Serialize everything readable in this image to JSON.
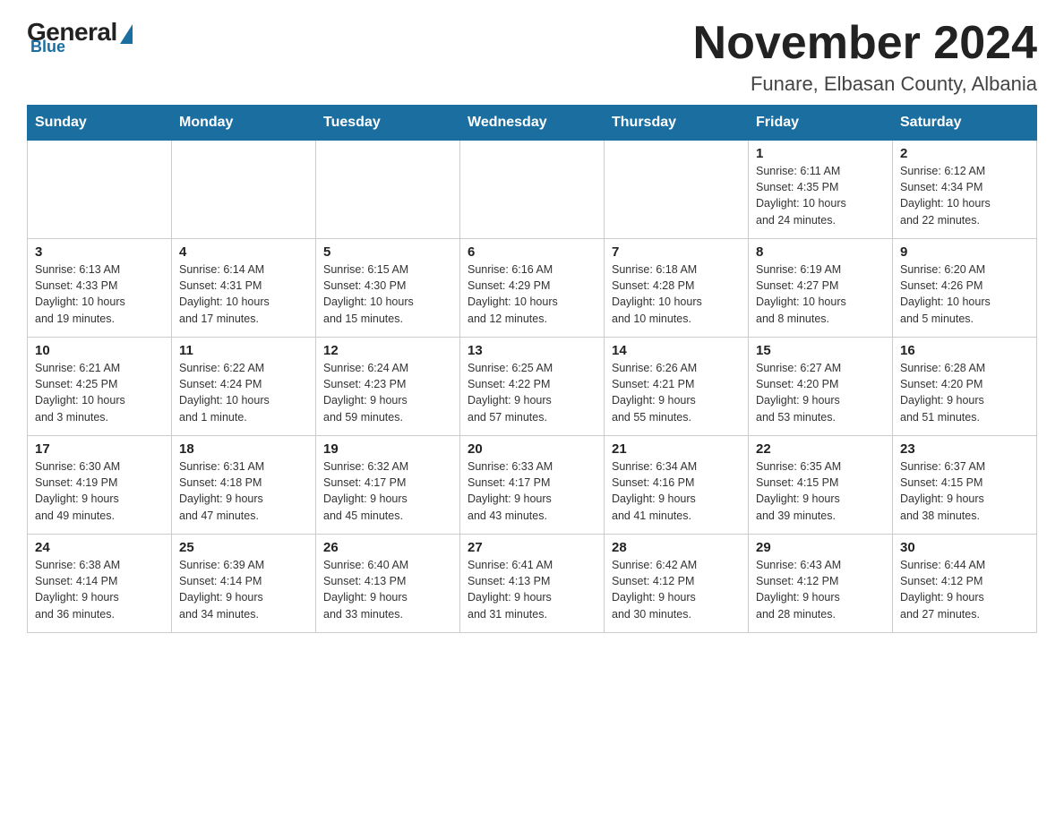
{
  "logo": {
    "general": "General",
    "blue": "Blue",
    "subtitle": "Blue"
  },
  "title": "November 2024",
  "location": "Funare, Elbasan County, Albania",
  "days_of_week": [
    "Sunday",
    "Monday",
    "Tuesday",
    "Wednesday",
    "Thursday",
    "Friday",
    "Saturday"
  ],
  "weeks": [
    [
      {
        "day": "",
        "info": ""
      },
      {
        "day": "",
        "info": ""
      },
      {
        "day": "",
        "info": ""
      },
      {
        "day": "",
        "info": ""
      },
      {
        "day": "",
        "info": ""
      },
      {
        "day": "1",
        "info": "Sunrise: 6:11 AM\nSunset: 4:35 PM\nDaylight: 10 hours\nand 24 minutes."
      },
      {
        "day": "2",
        "info": "Sunrise: 6:12 AM\nSunset: 4:34 PM\nDaylight: 10 hours\nand 22 minutes."
      }
    ],
    [
      {
        "day": "3",
        "info": "Sunrise: 6:13 AM\nSunset: 4:33 PM\nDaylight: 10 hours\nand 19 minutes."
      },
      {
        "day": "4",
        "info": "Sunrise: 6:14 AM\nSunset: 4:31 PM\nDaylight: 10 hours\nand 17 minutes."
      },
      {
        "day": "5",
        "info": "Sunrise: 6:15 AM\nSunset: 4:30 PM\nDaylight: 10 hours\nand 15 minutes."
      },
      {
        "day": "6",
        "info": "Sunrise: 6:16 AM\nSunset: 4:29 PM\nDaylight: 10 hours\nand 12 minutes."
      },
      {
        "day": "7",
        "info": "Sunrise: 6:18 AM\nSunset: 4:28 PM\nDaylight: 10 hours\nand 10 minutes."
      },
      {
        "day": "8",
        "info": "Sunrise: 6:19 AM\nSunset: 4:27 PM\nDaylight: 10 hours\nand 8 minutes."
      },
      {
        "day": "9",
        "info": "Sunrise: 6:20 AM\nSunset: 4:26 PM\nDaylight: 10 hours\nand 5 minutes."
      }
    ],
    [
      {
        "day": "10",
        "info": "Sunrise: 6:21 AM\nSunset: 4:25 PM\nDaylight: 10 hours\nand 3 minutes."
      },
      {
        "day": "11",
        "info": "Sunrise: 6:22 AM\nSunset: 4:24 PM\nDaylight: 10 hours\nand 1 minute."
      },
      {
        "day": "12",
        "info": "Sunrise: 6:24 AM\nSunset: 4:23 PM\nDaylight: 9 hours\nand 59 minutes."
      },
      {
        "day": "13",
        "info": "Sunrise: 6:25 AM\nSunset: 4:22 PM\nDaylight: 9 hours\nand 57 minutes."
      },
      {
        "day": "14",
        "info": "Sunrise: 6:26 AM\nSunset: 4:21 PM\nDaylight: 9 hours\nand 55 minutes."
      },
      {
        "day": "15",
        "info": "Sunrise: 6:27 AM\nSunset: 4:20 PM\nDaylight: 9 hours\nand 53 minutes."
      },
      {
        "day": "16",
        "info": "Sunrise: 6:28 AM\nSunset: 4:20 PM\nDaylight: 9 hours\nand 51 minutes."
      }
    ],
    [
      {
        "day": "17",
        "info": "Sunrise: 6:30 AM\nSunset: 4:19 PM\nDaylight: 9 hours\nand 49 minutes."
      },
      {
        "day": "18",
        "info": "Sunrise: 6:31 AM\nSunset: 4:18 PM\nDaylight: 9 hours\nand 47 minutes."
      },
      {
        "day": "19",
        "info": "Sunrise: 6:32 AM\nSunset: 4:17 PM\nDaylight: 9 hours\nand 45 minutes."
      },
      {
        "day": "20",
        "info": "Sunrise: 6:33 AM\nSunset: 4:17 PM\nDaylight: 9 hours\nand 43 minutes."
      },
      {
        "day": "21",
        "info": "Sunrise: 6:34 AM\nSunset: 4:16 PM\nDaylight: 9 hours\nand 41 minutes."
      },
      {
        "day": "22",
        "info": "Sunrise: 6:35 AM\nSunset: 4:15 PM\nDaylight: 9 hours\nand 39 minutes."
      },
      {
        "day": "23",
        "info": "Sunrise: 6:37 AM\nSunset: 4:15 PM\nDaylight: 9 hours\nand 38 minutes."
      }
    ],
    [
      {
        "day": "24",
        "info": "Sunrise: 6:38 AM\nSunset: 4:14 PM\nDaylight: 9 hours\nand 36 minutes."
      },
      {
        "day": "25",
        "info": "Sunrise: 6:39 AM\nSunset: 4:14 PM\nDaylight: 9 hours\nand 34 minutes."
      },
      {
        "day": "26",
        "info": "Sunrise: 6:40 AM\nSunset: 4:13 PM\nDaylight: 9 hours\nand 33 minutes."
      },
      {
        "day": "27",
        "info": "Sunrise: 6:41 AM\nSunset: 4:13 PM\nDaylight: 9 hours\nand 31 minutes."
      },
      {
        "day": "28",
        "info": "Sunrise: 6:42 AM\nSunset: 4:12 PM\nDaylight: 9 hours\nand 30 minutes."
      },
      {
        "day": "29",
        "info": "Sunrise: 6:43 AM\nSunset: 4:12 PM\nDaylight: 9 hours\nand 28 minutes."
      },
      {
        "day": "30",
        "info": "Sunrise: 6:44 AM\nSunset: 4:12 PM\nDaylight: 9 hours\nand 27 minutes."
      }
    ]
  ]
}
